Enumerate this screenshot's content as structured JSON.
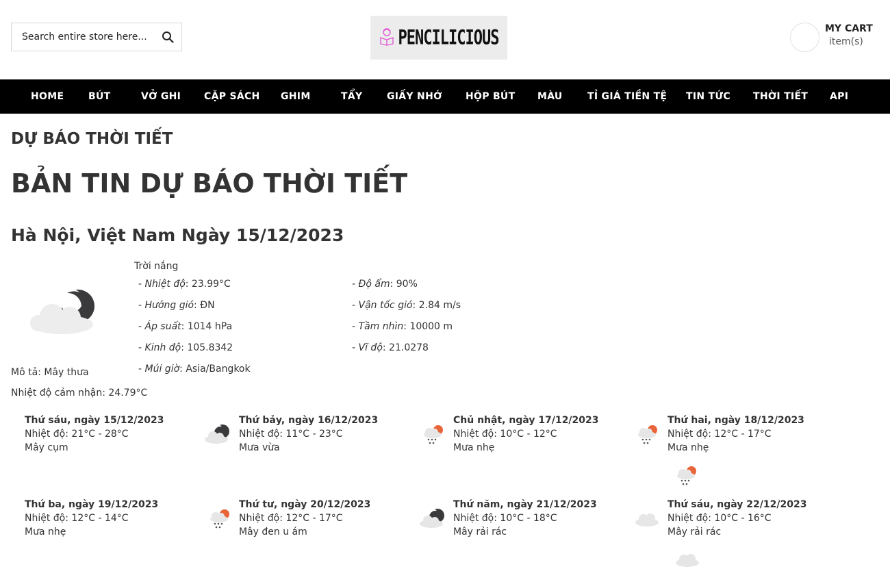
{
  "header": {
    "search": {
      "placeholder": "Search entire store here...",
      "icon": "search-icon"
    },
    "logo": {
      "text": "PENCILICIOUS",
      "icon": "reader-icon",
      "accent": "#e05ad6"
    },
    "cart": {
      "title": "MY CART",
      "items": "item(s)"
    }
  },
  "nav": {
    "items": [
      "HOME",
      "BÚT",
      "VỞ GHI",
      "CẶP SÁCH",
      "GHIM",
      "TẨY",
      "GIẤY NHỚ",
      "HỘP BÚT",
      "MÀU",
      "TỈ GIÁ TIỀN TỆ",
      "TIN TỨC",
      "THỜI TIẾT",
      "API"
    ]
  },
  "page": {
    "crumb_title": "DỰ BÁO THỜI TIẾT",
    "title": "BẢN TIN DỰ BÁO THỜI TIẾT",
    "city": "Hà Nội, Việt Nam Ngày 15/12/2023"
  },
  "current": {
    "state": "Trời nắng",
    "icon": "cloud-night-icon",
    "description": "Mô tả: Mây thưa",
    "feels_like": "Nhiệt độ cảm nhận: 24.79°C",
    "stats": [
      {
        "label": "Nhiệt độ",
        "value": ": 23.99°C"
      },
      {
        "label": "Độ ẩm",
        "value": ": 90%"
      },
      {
        "label": "Hướng gió",
        "value": ": ĐN"
      },
      {
        "label": "Vận tốc gió",
        "value": ": 2.84 m/s"
      },
      {
        "label": "Áp suất",
        "value": ": 1014 hPa"
      },
      {
        "label": "Tầm nhìn",
        "value": ": 10000 m"
      },
      {
        "label": "Kinh độ",
        "value": ": 105.8342"
      },
      {
        "label": "Vĩ độ",
        "value": ": 21.0278"
      },
      {
        "label": "Múi giờ",
        "value": ": Asia/Bangkok"
      }
    ],
    "stat_prefix": "- "
  },
  "forecast": [
    {
      "date": "Thứ sáu, ngày 15/12/2023",
      "temp": "Nhiệt độ: 21°C - 28°C",
      "desc": "Mây cụm",
      "icon": ""
    },
    {
      "date": "Thứ bảy, ngày 16/12/2023",
      "temp": "Nhiệt độ: 11°C - 23°C",
      "desc": "Mưa vừa",
      "icon": "cloud-night-icon"
    },
    {
      "date": "Chủ nhật, ngày 17/12/2023",
      "temp": "Nhiệt độ: 10°C - 12°C",
      "desc": "Mưa nhẹ",
      "icon": "rain-sun-icon"
    },
    {
      "date": "Thứ hai, ngày 18/12/2023",
      "temp": "Nhiệt độ: 12°C - 17°C",
      "desc": "Mưa nhẹ",
      "icon": "rain-sun-icon"
    },
    {
      "date": "Thứ ba, ngày 19/12/2023",
      "temp": "Nhiệt độ: 12°C - 14°C",
      "desc": "Mưa nhẹ",
      "icon": ""
    },
    {
      "date": "Thứ tư, ngày 20/12/2023",
      "temp": "Nhiệt độ: 12°C - 17°C",
      "desc": "Mây đen u ám",
      "icon": "rain-sun-icon"
    },
    {
      "date": "Thứ năm, ngày 21/12/2023",
      "temp": "Nhiệt độ: 10°C - 18°C",
      "desc": "Mây rải rác",
      "icon": "cloud-night-icon"
    },
    {
      "date": "Thứ sáu, ngày 22/12/2023",
      "temp": "Nhiệt độ: 10°C - 16°C",
      "desc": "Mây rải rác",
      "icon": "cloud-icon"
    }
  ],
  "stray_icons": [
    "rain-sun-icon",
    "cloud-icon"
  ]
}
